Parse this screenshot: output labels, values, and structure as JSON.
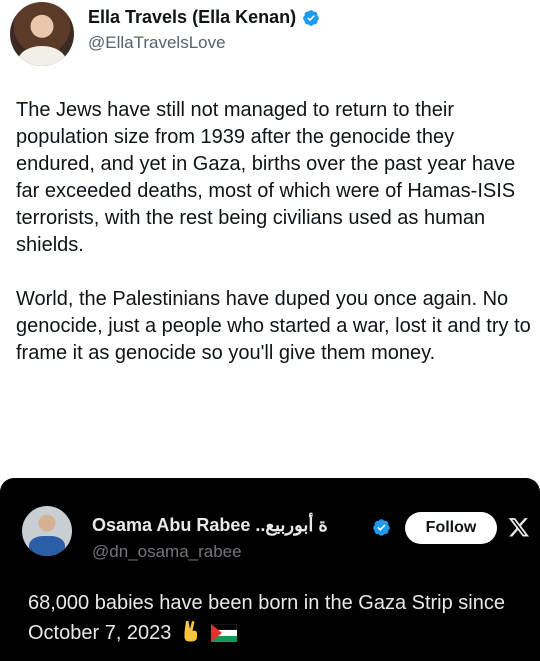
{
  "author": {
    "display_name": "Ella Travels (Ella Kenan)",
    "handle": "@EllaTravelsLove",
    "avatar_icon": "profile-photo"
  },
  "tweet": {
    "paragraphs": [
      "The Jews have still not managed to return to their population size from 1939 after the genocide they endured, and yet in Gaza, births over the past year have far exceeded deaths, most of which were of Hamas-ISIS terrorists, with the rest being civilians used as human shields.",
      "World, the Palestinians have duped you once again. No genocide, just a people who started a war, lost it and try to frame it as genocide so you'll give them money."
    ]
  },
  "quoted_tweet": {
    "display_name": "Osama Abu Rabee ..ة أبوربيع",
    "handle": "@dn_osama_rabee",
    "follow_label": "Follow",
    "text": "68,000 babies have been born in the Gaza Strip since October 7, 2023",
    "emojis": [
      "victory-hand-emoji",
      "palestine-flag-emoji"
    ]
  },
  "colors": {
    "verified": "#1d9bf0",
    "text_primary": "#0f1419",
    "text_secondary": "#536471",
    "quote_background": "#000000"
  }
}
